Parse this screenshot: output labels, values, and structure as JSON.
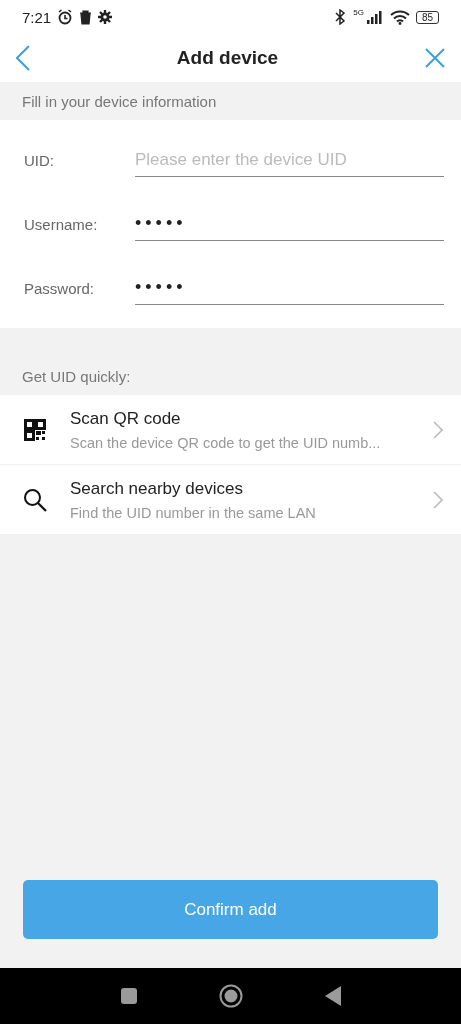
{
  "status_bar": {
    "time": "7:21",
    "network": "5G",
    "battery": "85"
  },
  "header": {
    "title": "Add device"
  },
  "form": {
    "heading": "Fill in your device information",
    "fields": [
      {
        "label": "UID:",
        "placeholder": "Please enter the device UID"
      },
      {
        "label": "Username:",
        "value": "•••••"
      },
      {
        "label": "Password:",
        "value": "•••••"
      }
    ]
  },
  "quick": {
    "heading": "Get UID quickly:",
    "items": [
      {
        "kind": "qr",
        "title": "Scan QR code",
        "subtitle": "Scan the device QR code to get the UID numb..."
      },
      {
        "kind": "search",
        "title": "Search nearby devices",
        "subtitle": "Find the UID number in the same LAN"
      }
    ]
  },
  "confirm_button": "Confirm add"
}
